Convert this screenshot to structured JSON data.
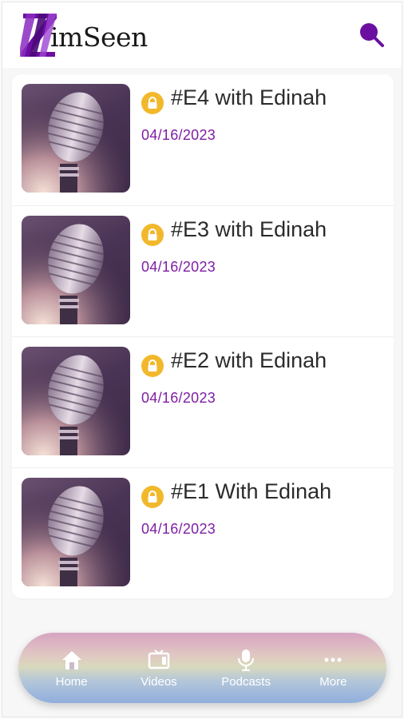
{
  "app": {
    "logo_text": "imSeen",
    "brand_color": "#6a0fa0",
    "search_icon": "search-icon"
  },
  "episodes": [
    {
      "title": "#E4 with Edinah",
      "date": "04/16/2023",
      "locked": true,
      "thumb_icon": "microphone-image"
    },
    {
      "title": "#E3 with Edinah",
      "date": "04/16/2023",
      "locked": true,
      "thumb_icon": "microphone-image"
    },
    {
      "title": "#E2 with Edinah",
      "date": "04/16/2023",
      "locked": true,
      "thumb_icon": "microphone-image"
    },
    {
      "title": "#E1 With Edinah",
      "date": "04/16/2023",
      "locked": true,
      "thumb_icon": "microphone-image"
    }
  ],
  "colors": {
    "date": "#7e1ea3",
    "lock_badge": "#f2b82c"
  },
  "nav": {
    "items": [
      {
        "label": "Home",
        "icon": "home-icon"
      },
      {
        "label": "Videos",
        "icon": "tv-icon"
      },
      {
        "label": "Podcasts",
        "icon": "microphone-icon"
      },
      {
        "label": "More",
        "icon": "more-dots-icon"
      }
    ]
  }
}
